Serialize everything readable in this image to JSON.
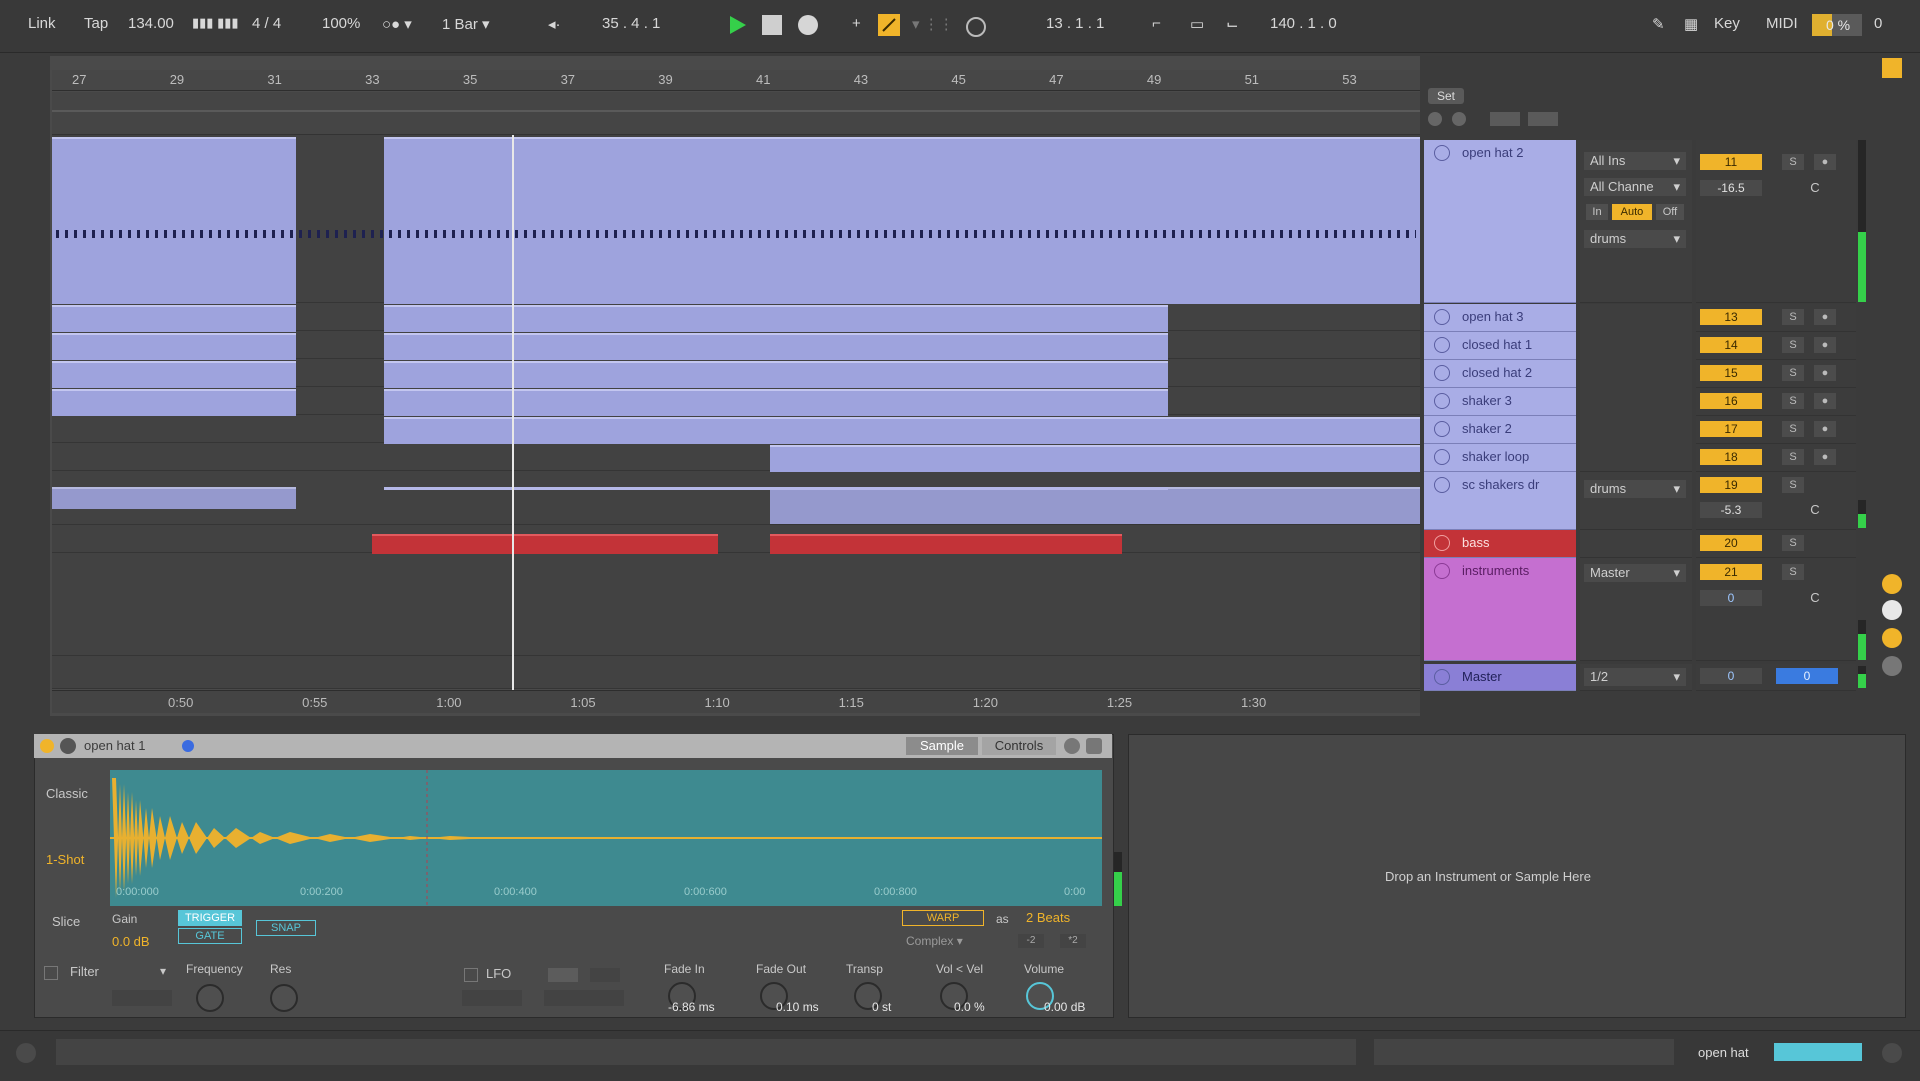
{
  "transport": {
    "link": "Link",
    "tap": "Tap",
    "tempo": "134.00",
    "signature": "4 / 4",
    "zoom": "100%",
    "quantize": "1 Bar",
    "position": "35 .  4 .  1",
    "loop_start": "13 .  1 .  1",
    "loop_length": "140 .  1 .  0",
    "key": "Key",
    "midi": "MIDI",
    "cpu": "0 %",
    "cpu_digit": "0"
  },
  "ruler": {
    "bars": [
      "27",
      "29",
      "31",
      "33",
      "35",
      "37",
      "39",
      "41",
      "43",
      "45",
      "47",
      "49",
      "51",
      "53"
    ],
    "times": [
      "0:50",
      "0:55",
      "1:00",
      "1:05",
      "1:10",
      "1:15",
      "1:20",
      "1:25",
      "1:30"
    ]
  },
  "set_label": "Set",
  "tracks": [
    {
      "name": "open hat 2",
      "number": "11",
      "input": "All Ins",
      "channel": "All Channe",
      "monitor": [
        "In",
        "Auto",
        "Off"
      ],
      "output": "drums",
      "volume": "-16.5",
      "pan": "C"
    },
    {
      "name": "open hat 3",
      "number": "13"
    },
    {
      "name": "closed hat 1",
      "number": "14"
    },
    {
      "name": "closed hat 2",
      "number": "15"
    },
    {
      "name": "shaker 3",
      "number": "16"
    },
    {
      "name": "shaker 2",
      "number": "17"
    },
    {
      "name": "shaker loop",
      "number": "18"
    },
    {
      "name": "sc shakers dr",
      "number": "19",
      "output": "drums",
      "volume": "-5.3",
      "pan": "C"
    },
    {
      "name": "bass",
      "number": "20"
    },
    {
      "name": "instruments",
      "number": "21",
      "output": "Master",
      "volume": "0",
      "pan": "C"
    },
    {
      "name": "Master",
      "output": "1/2",
      "volume": "0",
      "pan": "0"
    }
  ],
  "solo_label": "S",
  "device": {
    "title": "open hat 1",
    "tabs": [
      "Sample",
      "Controls"
    ],
    "modes": [
      "Classic",
      "1-Shot",
      "Slice"
    ],
    "gain_label": "Gain",
    "gain_value": "0.0 dB",
    "trigger": "TRIGGER",
    "gate": "GATE",
    "snap": "SNAP",
    "warp": "WARP",
    "as_label": "as",
    "beats": "2 Beats",
    "warp_mode": "Complex",
    "halve": "-2",
    "double": "*2",
    "wave_ticks": [
      "0:00:000",
      "0:00:200",
      "0:00:400",
      "0:00:600",
      "0:00:800",
      "0:00"
    ],
    "filter_label": "Filter",
    "frequency_label": "Frequency",
    "res_label": "Res",
    "lfo_label": "LFO",
    "fade_in_label": "Fade In",
    "fade_in_value": "-6.86 ms",
    "fade_out_label": "Fade Out",
    "fade_out_value": "0.10 ms",
    "transp_label": "Transp",
    "transp_value": "0 st",
    "velvol_label": "Vol < Vel",
    "velvol_value": "0.0 %",
    "volume_label": "Volume",
    "volume_value": "0.00 dB"
  },
  "dropzone": "Drop an Instrument or Sample Here",
  "status": {
    "track_name": "open hat"
  },
  "colors": {
    "clip": "#9ea3dd",
    "bass": "#c33338",
    "instruments": "#c56fd0",
    "accent": "#f0b42a",
    "waveform": "#e8b030",
    "wave_bg": "#3e8a90"
  }
}
